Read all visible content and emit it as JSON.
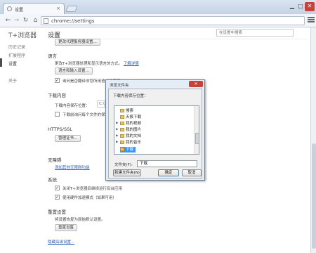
{
  "browser": {
    "tab_title": "设置",
    "url": "chrome://settings",
    "window_controls": {
      "minimize": "▁",
      "maximize": "□",
      "close": "✕"
    }
  },
  "sidebar": {
    "app_title": "T+浏览器",
    "items": [
      "历史记录",
      "扩展程序",
      "设置",
      "关于"
    ],
    "active": "设置"
  },
  "settings": {
    "title": "设置",
    "search_placeholder": "在设置中搜索",
    "proxy_button": "更改代理服务器设置...",
    "language": {
      "heading": "语言",
      "description": "更改T+浏览器处理和显示语言的方式。",
      "learn_more": "了解详情",
      "button": "语言和输入设置...",
      "translate_option": "询问是否翻译非您所用语言的网页"
    },
    "downloads": {
      "heading": "下载内容",
      "location_label": "下载内容保存位置：",
      "location_value": "C:\\Users\\Administrator\\Downloads",
      "ask_option": "下载前询问每个文件的保存位置"
    },
    "https": {
      "heading": "HTTPS/SSL",
      "button": "管理证书..."
    },
    "accessibility": {
      "heading": "无障碍",
      "link": "添加其他无障碍功能"
    },
    "system": {
      "heading": "系统",
      "option_background": "关闭T+浏览器后继续运行后台应用",
      "option_hw_accel": "使用硬件加速模式（如果可用）"
    },
    "reset": {
      "heading": "重置设置",
      "description": "将设置恢复为原始默认设置。",
      "button": "重置设置"
    },
    "hide_advanced_link": "隐藏高级设置..."
  },
  "dialog": {
    "title": "浏览文件夹",
    "close": "✕",
    "prompt": "下载内容保存位置：",
    "tree": [
      "搜索",
      "天极下载",
      "我的视频",
      "我的图片",
      "我的文档",
      "我的音乐",
      "下载"
    ],
    "selected": "下载",
    "folder_label": "文件夹(F):",
    "folder_value": "下载",
    "new_folder_button": "新建文件夹(N)",
    "ok_button": "确定",
    "cancel_button": "取消"
  },
  "colors": {
    "link": "#2a5db0",
    "selection": "#3399ff",
    "close_button": "#c7433a"
  }
}
